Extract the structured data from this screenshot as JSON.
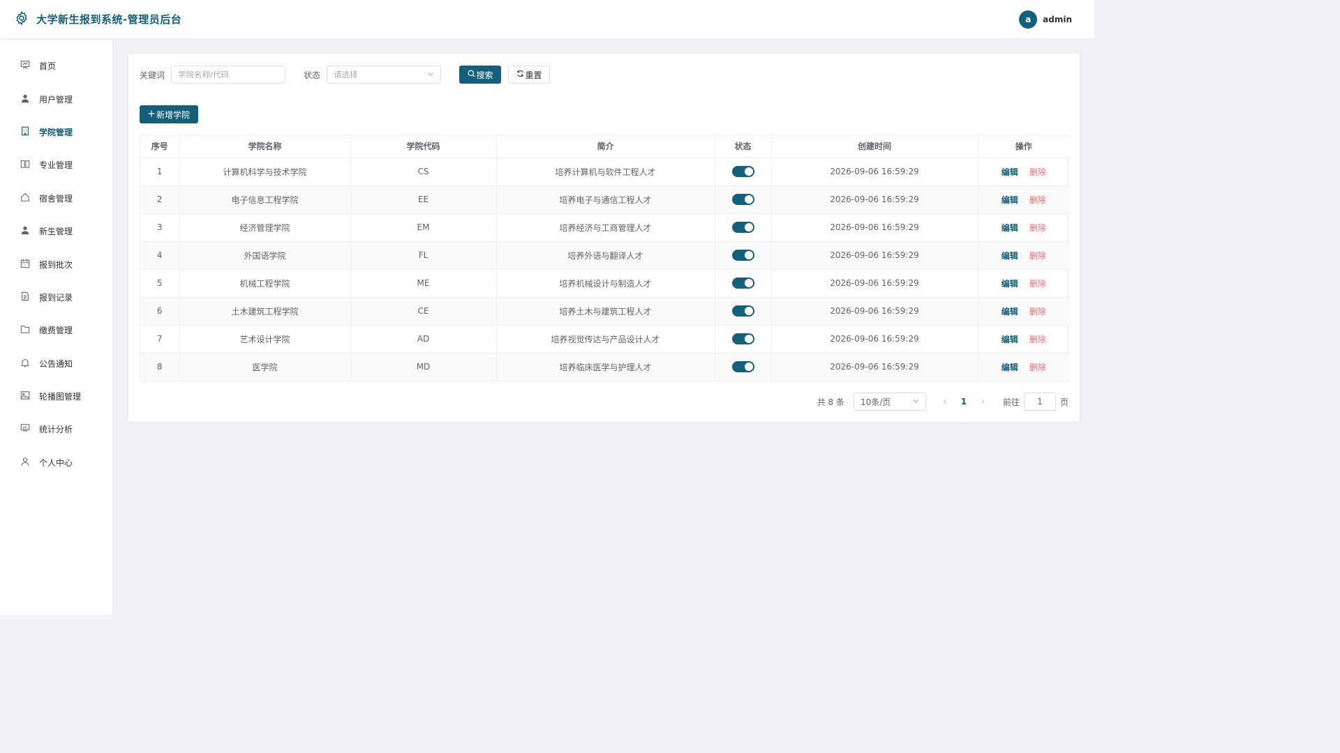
{
  "header": {
    "title": "大学新生报到系统-管理员后台",
    "avatar_letter": "a",
    "username": "admin"
  },
  "sidebar": {
    "items": [
      {
        "label": "首页",
        "icon": "dashboard-icon"
      },
      {
        "label": "用户管理",
        "icon": "user-icon"
      },
      {
        "label": "学院管理",
        "icon": "building-icon",
        "active": true
      },
      {
        "label": "专业管理",
        "icon": "book-icon"
      },
      {
        "label": "宿舍管理",
        "icon": "house-icon"
      },
      {
        "label": "新生管理",
        "icon": "user-icon"
      },
      {
        "label": "报到批次",
        "icon": "calendar-icon"
      },
      {
        "label": "报到记录",
        "icon": "document-icon"
      },
      {
        "label": "缴费管理",
        "icon": "folder-icon"
      },
      {
        "label": "公告通知",
        "icon": "bell-icon"
      },
      {
        "label": "轮播图管理",
        "icon": "picture-icon"
      },
      {
        "label": "统计分析",
        "icon": "chart-board-icon"
      },
      {
        "label": "个人中心",
        "icon": "user-outline-icon"
      }
    ]
  },
  "filters": {
    "keyword_label": "关键词",
    "keyword_placeholder": "学院名称/代码",
    "status_label": "状态",
    "status_placeholder": "请选择",
    "search_label": "搜索",
    "reset_label": "重置"
  },
  "toolbar": {
    "add_label": "新增学院"
  },
  "table": {
    "columns": [
      "序号",
      "学院名称",
      "学院代码",
      "简介",
      "状态",
      "创建时间",
      "操作"
    ],
    "edit_label": "编辑",
    "delete_label": "删除",
    "rows": [
      {
        "idx": "1",
        "name": "计算机科学与技术学院",
        "code": "CS",
        "desc": "培养计算机与软件工程人才",
        "enabled": true,
        "created": "2026-09-06 16:59:29"
      },
      {
        "idx": "2",
        "name": "电子信息工程学院",
        "code": "EE",
        "desc": "培养电子与通信工程人才",
        "enabled": true,
        "created": "2026-09-06 16:59:29"
      },
      {
        "idx": "3",
        "name": "经济管理学院",
        "code": "EM",
        "desc": "培养经济与工商管理人才",
        "enabled": true,
        "created": "2026-09-06 16:59:29"
      },
      {
        "idx": "4",
        "name": "外国语学院",
        "code": "FL",
        "desc": "培养外语与翻译人才",
        "enabled": true,
        "created": "2026-09-06 16:59:29"
      },
      {
        "idx": "5",
        "name": "机械工程学院",
        "code": "ME",
        "desc": "培养机械设计与制造人才",
        "enabled": true,
        "created": "2026-09-06 16:59:29"
      },
      {
        "idx": "6",
        "name": "土木建筑工程学院",
        "code": "CE",
        "desc": "培养土木与建筑工程人才",
        "enabled": true,
        "created": "2026-09-06 16:59:29"
      },
      {
        "idx": "7",
        "name": "艺术设计学院",
        "code": "AD",
        "desc": "培养视觉传达与产品设计人才",
        "enabled": true,
        "created": "2026-09-06 16:59:29"
      },
      {
        "idx": "8",
        "name": "医学院",
        "code": "MD",
        "desc": "培养临床医学与护理人才",
        "enabled": true,
        "created": "2026-09-06 16:59:29"
      }
    ]
  },
  "pagination": {
    "total_text": "共 8 条",
    "page_size": "10条/页",
    "current_page": "1",
    "goto_label": "前往",
    "goto_value": "1",
    "page_unit": "页"
  },
  "colors": {
    "primary": "#14607a",
    "danger": "#f56c6c",
    "background": "#f0f2f5"
  }
}
